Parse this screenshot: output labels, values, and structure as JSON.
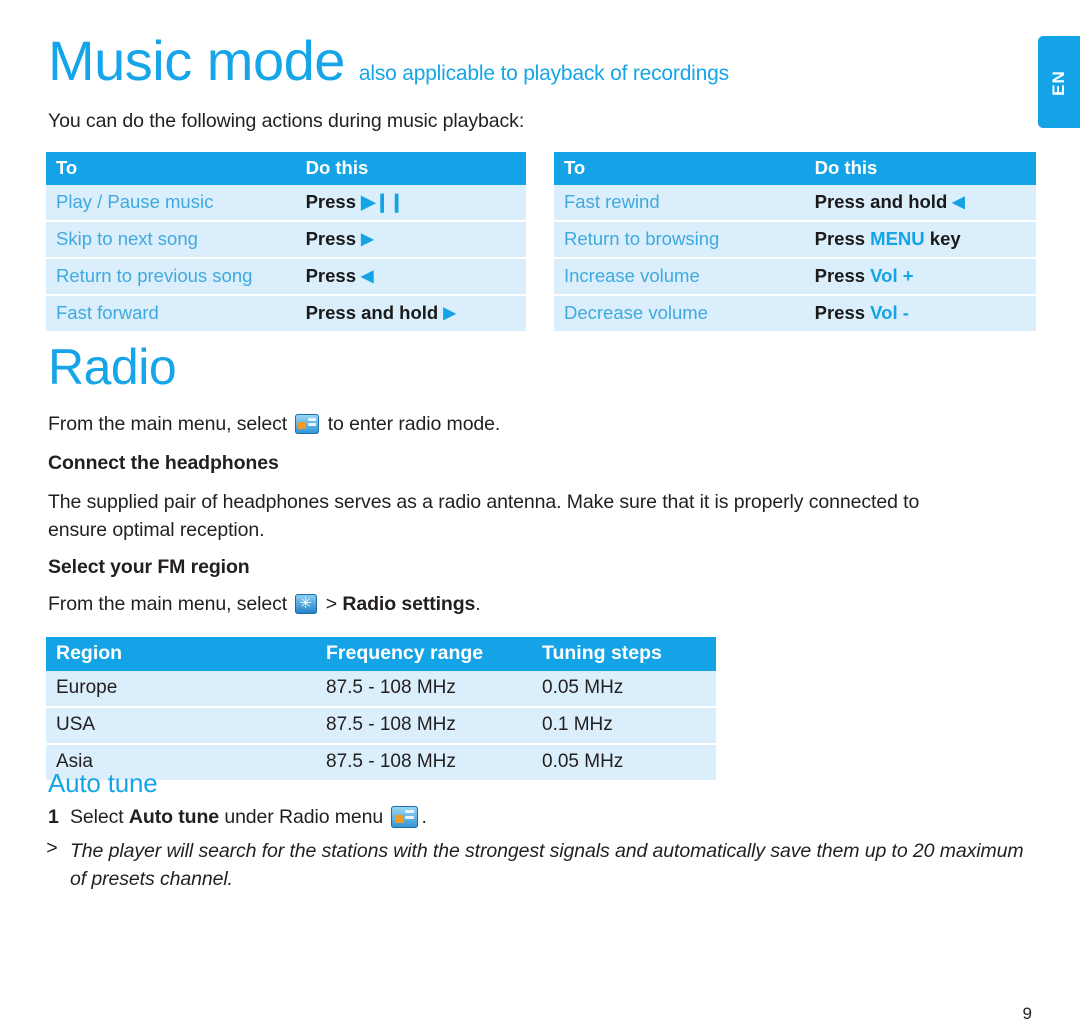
{
  "side_tab": {
    "label": "EN"
  },
  "header": {
    "title": "Music mode",
    "subtitle": "also applicable to playback of recordings",
    "intro": "You can do the following actions during music playback:"
  },
  "music_table_left": {
    "headers": [
      "To",
      "Do this"
    ],
    "rows": [
      {
        "to": "Play / Pause music",
        "do_prefix": "Press ",
        "glyph": "play-pause-icon",
        "do_suffix": ""
      },
      {
        "to": "Skip to next song",
        "do_prefix": "Press ",
        "glyph": "play-right-icon",
        "do_suffix": ""
      },
      {
        "to": "Return to previous song",
        "do_prefix": "Press ",
        "glyph": "play-left-icon",
        "do_suffix": ""
      },
      {
        "to": "Fast forward",
        "do_prefix": "Press and hold ",
        "glyph": "play-right-icon",
        "do_suffix": ""
      }
    ]
  },
  "music_table_right": {
    "headers": [
      "To",
      "Do this"
    ],
    "rows": [
      {
        "to": "Fast rewind",
        "do_prefix": "Press and hold ",
        "glyph": "play-left-icon",
        "do_suffix": ""
      },
      {
        "to": "Return to browsing",
        "do_prefix": "Press ",
        "key": "MENU",
        "do_suffix": " key"
      },
      {
        "to": "Increase volume",
        "do_prefix": "Press ",
        "key": "Vol +",
        "do_suffix": ""
      },
      {
        "to": "Decrease volume",
        "do_prefix": "Press ",
        "key": "Vol -",
        "do_suffix": ""
      }
    ]
  },
  "radio": {
    "title": "Radio",
    "enter_line_before": "From the main menu, select ",
    "enter_line_after": " to enter radio mode.",
    "connect_heading": "Connect the headphones",
    "connect_body": "The supplied pair of headphones serves as a radio antenna. Make sure that it is properly connected to ensure optimal reception.",
    "fm_heading": "Select your FM region",
    "fm_line_before": "From the main menu, select ",
    "fm_line_mid": " > ",
    "fm_line_bold": "Radio settings",
    "fm_line_after": "."
  },
  "region_table": {
    "headers": [
      "Region",
      "Frequency range",
      "Tuning steps"
    ],
    "rows": [
      {
        "region": "Europe",
        "frequency": "87.5 - 108 MHz",
        "steps": "0.05 MHz"
      },
      {
        "region": "USA",
        "frequency": "87.5 - 108 MHz",
        "steps": "0.1 MHz"
      },
      {
        "region": "Asia",
        "frequency": "87.5 - 108 MHz",
        "steps": "0.05 MHz"
      }
    ]
  },
  "auto_tune": {
    "title": "Auto tune",
    "step_number": "1",
    "step_before": "Select ",
    "step_bold": "Auto tune",
    "step_after": " under Radio menu ",
    "step_end": ".",
    "note_marker": ">",
    "note": "The player will search for the stations with the strongest signals and automatically save them up to 20 maximum of presets channel."
  },
  "footer": {
    "page_number": "9"
  }
}
